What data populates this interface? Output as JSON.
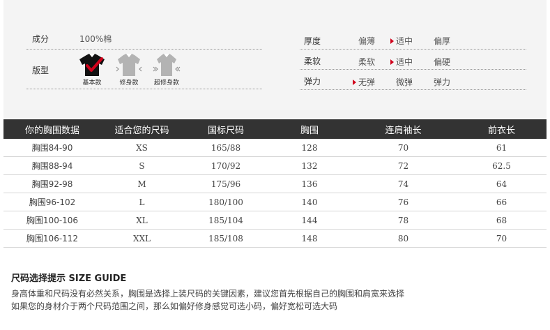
{
  "attributes": {
    "material_label": "成分",
    "material_value": "100%棉",
    "fit_label": "版型",
    "fits": [
      {
        "name": "基本款",
        "selected": true
      },
      {
        "name": "修身款",
        "selected": false
      },
      {
        "name": "超修身款",
        "selected": false
      }
    ]
  },
  "ratings": [
    {
      "label": "厚度",
      "options": [
        "偏薄",
        "适中",
        "偏厚"
      ],
      "selected_index": 1
    },
    {
      "label": "柔软",
      "options": [
        "柔软",
        "适中",
        "偏硬"
      ],
      "selected_index": 1
    },
    {
      "label": "弹力",
      "options": [
        "无弹",
        "微弹",
        "弹力"
      ],
      "selected_index": 0
    }
  ],
  "table": {
    "headers": [
      "你的胸围数据",
      "适合您的尺码",
      "国标尺码",
      "胸围",
      "连肩袖长",
      "前衣长"
    ],
    "rows": [
      [
        "胸围84-90",
        "XS",
        "165/88",
        "128",
        "70",
        "61"
      ],
      [
        "胸围88-94",
        "S",
        "170/92",
        "132",
        "72",
        "62.5"
      ],
      [
        "胸围92-98",
        "M",
        "175/96",
        "136",
        "74",
        "64"
      ],
      [
        "胸围96-102",
        "L",
        "180/100",
        "140",
        "76",
        "66"
      ],
      [
        "胸围100-106",
        "XL",
        "185/104",
        "144",
        "78",
        "68"
      ],
      [
        "胸围106-112",
        "XXL",
        "185/108",
        "148",
        "80",
        "70"
      ]
    ]
  },
  "guide": {
    "title": "尺码选择提示 SIZE GUIDE",
    "line1": "身高体重和尺码没有必然关系，胸围是选择上装尺码的关键因素，建议您首先根据自己的胸围和肩宽来选择",
    "line2": "如果您的身材介于两个尺码范围之间，那么如偏好修身感觉可选小码，偏好宽松可选大码"
  },
  "colors": {
    "header_bg": "#333333",
    "accent_red": "#d0021b",
    "panel_bg": "#f4f4f4",
    "inactive_icon": "#b3b3b3"
  },
  "icons": [
    "shirt-basic-icon",
    "shirt-slim-icon",
    "shirt-extra-slim-icon",
    "check-icon",
    "selected-marker-icon"
  ]
}
